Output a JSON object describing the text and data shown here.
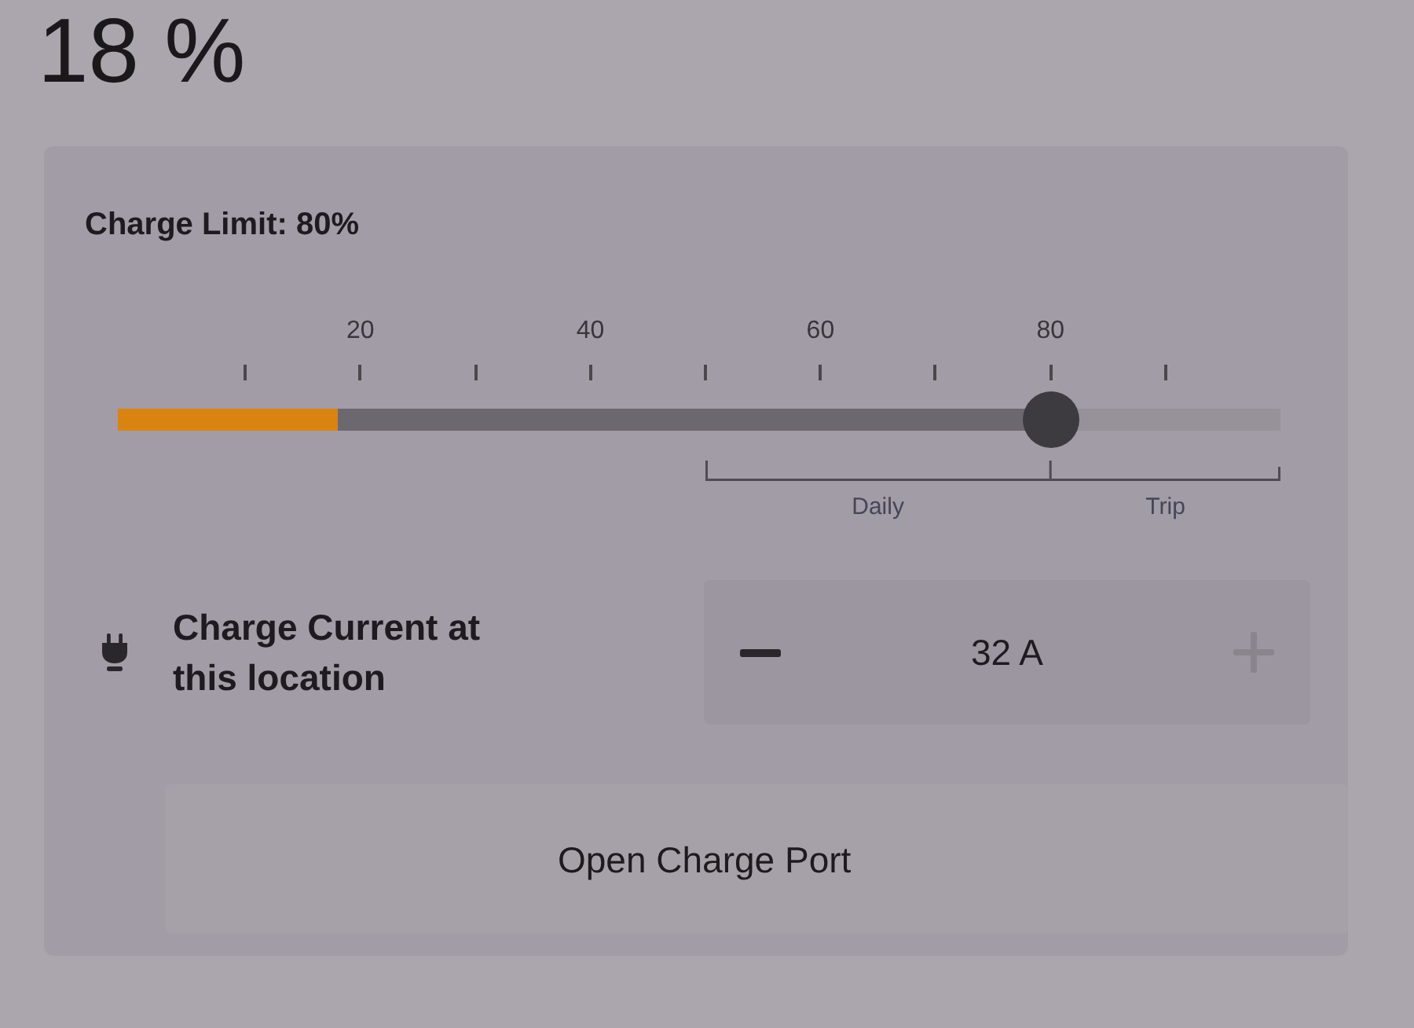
{
  "battery": {
    "percent": "18 %",
    "level": 0.18
  },
  "charge_limit": {
    "label": "Charge Limit: 80%",
    "scale_labels": [
      "20",
      "40",
      "60",
      "80"
    ],
    "level": 0.8,
    "ranges": [
      {
        "label": "Daily"
      },
      {
        "label": "Trip"
      }
    ]
  },
  "charge_current": {
    "label": "Charge Current at this location",
    "value": "32 A",
    "decrease": {
      "disabled": false
    },
    "increase": {
      "disabled": true
    }
  },
  "buttons": [
    {
      "label": "Open Charge Port"
    }
  ]
}
